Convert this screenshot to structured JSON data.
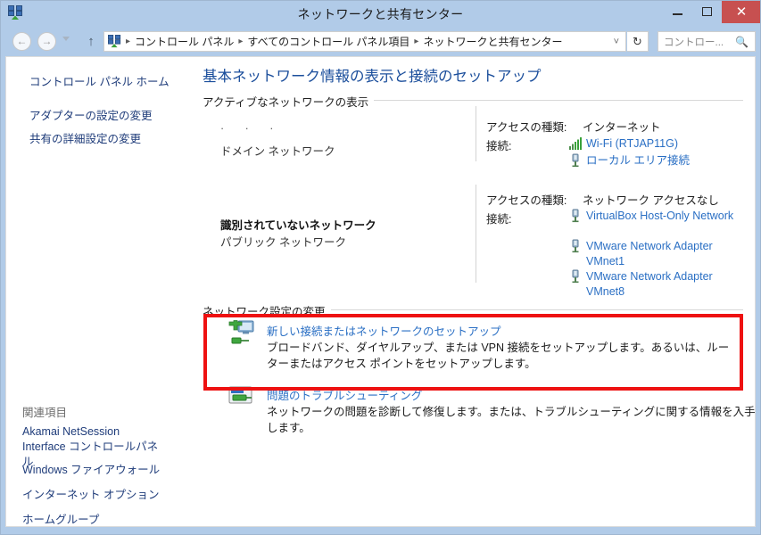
{
  "window": {
    "title": "ネットワークと共有センター",
    "icon": "network-sharing-center-icon",
    "controls": {
      "minimize": "—",
      "maximize": "□",
      "close": "✕"
    }
  },
  "navigation": {
    "back_icon": "◄",
    "forward_icon": "►",
    "recent_icon": "chevron-down-icon",
    "up_icon": "↑",
    "refresh_icon": "↻",
    "dropdown_icon": "˅",
    "breadcrumb_icon": "network-sharing-center-icon",
    "breadcrumb_separator": "▸",
    "breadcrumb": [
      "コントロール パネル",
      "すべてのコントロール パネル項目",
      "ネットワークと共有センター"
    ],
    "search": {
      "placeholder": "コントロー...",
      "icon": "search-icon"
    }
  },
  "sidebar": {
    "home_link": "コントロール パネル ホーム",
    "links": [
      "アダプターの設定の変更",
      "共有の詳細設定の変更"
    ],
    "related_header": "関連項目",
    "related_links": [
      "Akamai NetSession Interface コントロールパネル",
      "Windows ファイアウォール",
      "インターネット オプション",
      "ホームグループ"
    ]
  },
  "main": {
    "page_title": "基本ネットワーク情報の表示と接続のセットアップ",
    "sections": [
      {
        "label": "アクティブなネットワークの表示"
      },
      {
        "label": "ネットワーク設定の変更"
      }
    ],
    "networks": [
      {
        "icon_placeholder": "·   ·  ·",
        "name": "ドメイン ネットワーク",
        "name_bold": false,
        "profile": "",
        "access_label": "アクセスの種類:",
        "access_value": "インターネット",
        "connections_label": "接続:",
        "connections": [
          {
            "name": "Wi-Fi (RTJAP11G)",
            "icon": "wifi-signal-icon"
          },
          {
            "name": "ローカル エリア接続",
            "icon": "ethernet-icon"
          }
        ]
      },
      {
        "icon_placeholder": "",
        "name": "識別されていないネットワーク",
        "name_bold": true,
        "profile": "パブリック ネットワーク",
        "access_label": "アクセスの種類:",
        "access_value": "ネットワーク アクセスなし",
        "connections_label": "接続:",
        "connections": [
          {
            "name": "VirtualBox Host-Only Network",
            "icon": "ethernet-icon"
          },
          {
            "name": "VMware Network Adapter VMnet1",
            "icon": "ethernet-icon"
          },
          {
            "name": "VMware Network Adapter VMnet8",
            "icon": "ethernet-icon"
          }
        ]
      }
    ],
    "actions": [
      {
        "icon": "new-connection-icon",
        "title": "新しい接続またはネットワークのセットアップ",
        "description": "ブロードバンド、ダイヤルアップ、または VPN 接続をセットアップします。あるいは、ルーターまたはアクセス ポイントをセットアップします。",
        "highlighted": true
      },
      {
        "icon": "troubleshoot-icon",
        "title": "問題のトラブルシューティング",
        "description": "ネットワークの問題を診断して修復します。または、トラブルシューティングに関する情報を入手します。",
        "highlighted": false
      }
    ]
  },
  "colors": {
    "window_frame": "#b1cbe8",
    "close_button": "#c75050",
    "link": "#2a6fc4",
    "title_link": "#1c4f9c",
    "sidebar_link": "#1f3c7a",
    "highlight_box": "#ee1111"
  }
}
